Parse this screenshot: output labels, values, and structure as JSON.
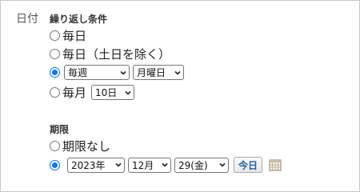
{
  "field": {
    "label": "日付"
  },
  "repeat": {
    "heading": "繰り返し条件",
    "options": [
      {
        "label": "毎日",
        "checked": false
      },
      {
        "label": "毎日（土日を除く）",
        "checked": false
      },
      {
        "label": "",
        "checked": true,
        "frequency": "毎週",
        "weekday": "月曜日"
      },
      {
        "label": "毎月",
        "checked": false,
        "day": "10日"
      }
    ]
  },
  "period": {
    "heading": "期限",
    "options": [
      {
        "label": "期限なし",
        "checked": false
      },
      {
        "label": "",
        "checked": true,
        "year": "2023年",
        "month": "12月",
        "day": "29(金)",
        "today_button": "今日"
      }
    ]
  },
  "icons": {
    "calendar": "calendar-icon",
    "caret": "chevron-down-icon"
  },
  "colors": {
    "accent": "#0075ff",
    "today_text": "#1f5fa8"
  }
}
